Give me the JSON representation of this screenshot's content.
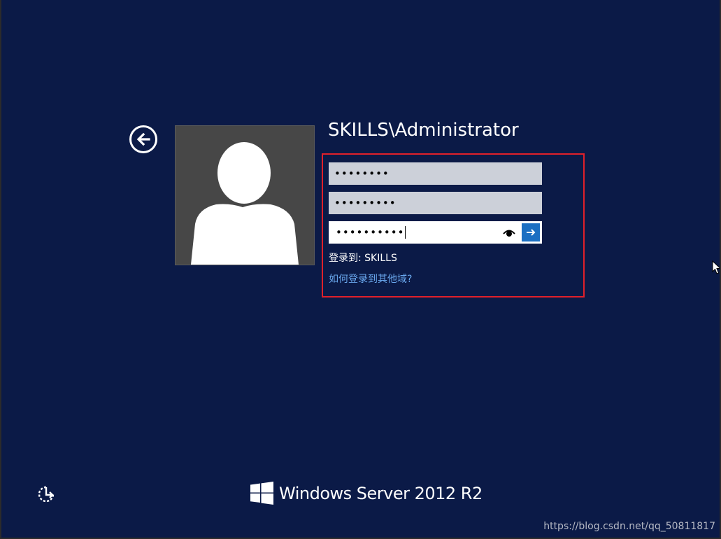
{
  "login": {
    "username": "SKILLS\\Administrator",
    "password_fields": [
      {
        "masked_value": "••••••••"
      },
      {
        "masked_value": "•••••••••"
      },
      {
        "masked_value": "••••••••••"
      }
    ],
    "sign_in_to": "登录到: SKILLS",
    "other_domain_link": "如何登录到其他域?"
  },
  "icons": {
    "back": "back-arrow-icon",
    "avatar": "user-silhouette-icon",
    "reveal": "eye-icon",
    "submit": "arrow-right-icon",
    "ease_of_access": "ease-of-access-icon",
    "brand_logo": "windows-logo-icon",
    "cursor": "mouse-pointer-icon"
  },
  "branding": {
    "product_name": "Windows Server 2012 R2"
  },
  "watermark": {
    "text": "https://blog.csdn.net/qq_50811817"
  },
  "colors": {
    "background": "#0b1a47",
    "highlight_border": "#e0202a",
    "submit_button": "#1b6fc2",
    "link": "#6aa8ee",
    "avatar_bg": "#474747"
  }
}
